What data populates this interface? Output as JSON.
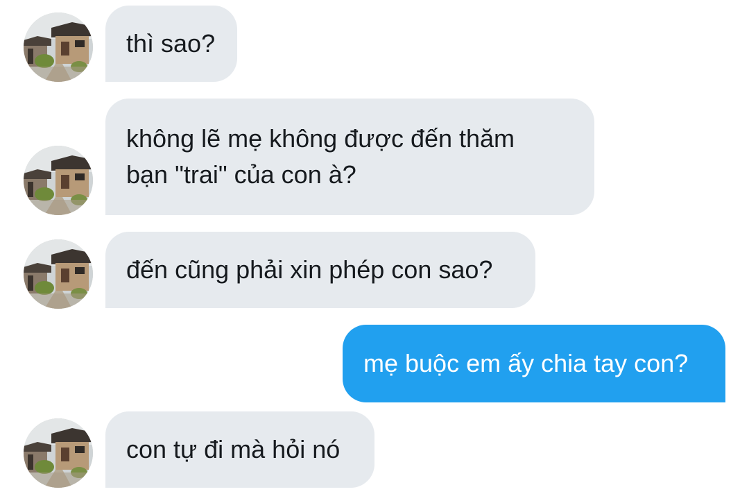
{
  "conversation": {
    "messages": [
      {
        "sender": "other",
        "text": "thì sao?"
      },
      {
        "sender": "other",
        "text": "không lẽ mẹ không được đến thăm\nbạn \"trai\" của con à?"
      },
      {
        "sender": "other",
        "text": "đến cũng phải xin phép con sao?"
      },
      {
        "sender": "me",
        "text": "mẹ buộc em ấy chia tay con?"
      },
      {
        "sender": "other",
        "text": "con tự đi mà hỏi nó"
      }
    ]
  },
  "colors": {
    "incoming_bubble": "#e6eaee",
    "outgoing_bubble": "#21a0ef",
    "incoming_text": "#161a1e",
    "outgoing_text": "#ffffff"
  },
  "icons": {
    "avatar": "hanok-alley-photo-avatar"
  }
}
